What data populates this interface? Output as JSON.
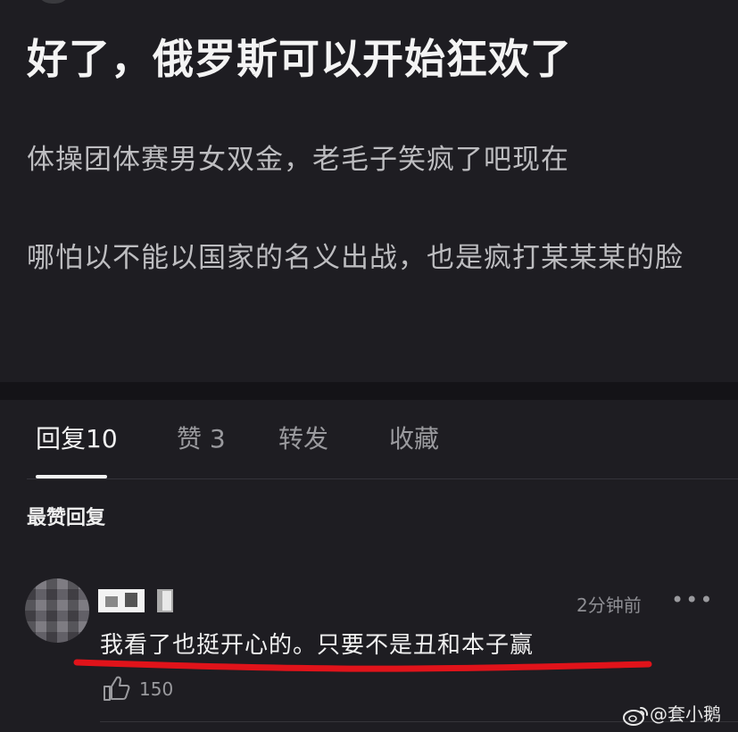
{
  "post": {
    "title": "好了，俄罗斯可以开始狂欢了",
    "paragraphs": [
      "体操团体赛男女双金，老毛子笑疯了吧现在",
      "哪怕以不能以国家的名义出战，也是疯打某某某的脸"
    ]
  },
  "tabs": [
    {
      "label": "回复",
      "count": "10"
    },
    {
      "label": "赞",
      "count": "3"
    },
    {
      "label": "转发",
      "count": ""
    },
    {
      "label": "收藏",
      "count": ""
    }
  ],
  "section_title": "最赞回复",
  "comment": {
    "time": "2分钟前",
    "more": "•••",
    "text": "我看了也挺开心的。只要不是丑和本子赢",
    "likes": "150",
    "highlight_color": "#e0131a"
  },
  "watermark": {
    "text": "@套小鹅",
    "icon": "weibo-icon"
  }
}
